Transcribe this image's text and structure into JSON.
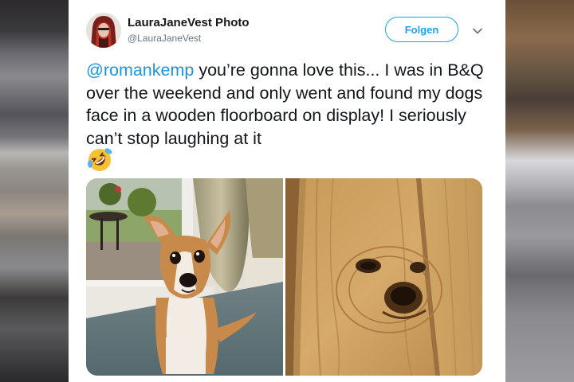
{
  "tweet": {
    "display_name": "LauraJaneVest Photo",
    "handle": "@LauraJaneVest",
    "follow_label": "Folgen",
    "mention": "@romankemp",
    "body": " you’re gonna love this... I was in B&Q over the weekend and only went and found my dogs face in a wooden floorboard on display! I seriously can’t stop laughing at it"
  },
  "icons": {
    "more": "chevron-down-icon",
    "emoji": "rolling-on-floor-laughing-emoji"
  },
  "colors": {
    "accent": "#1da1f2",
    "mention": "#1b95e0",
    "text": "#14171a",
    "secondary_text": "#657786"
  }
}
